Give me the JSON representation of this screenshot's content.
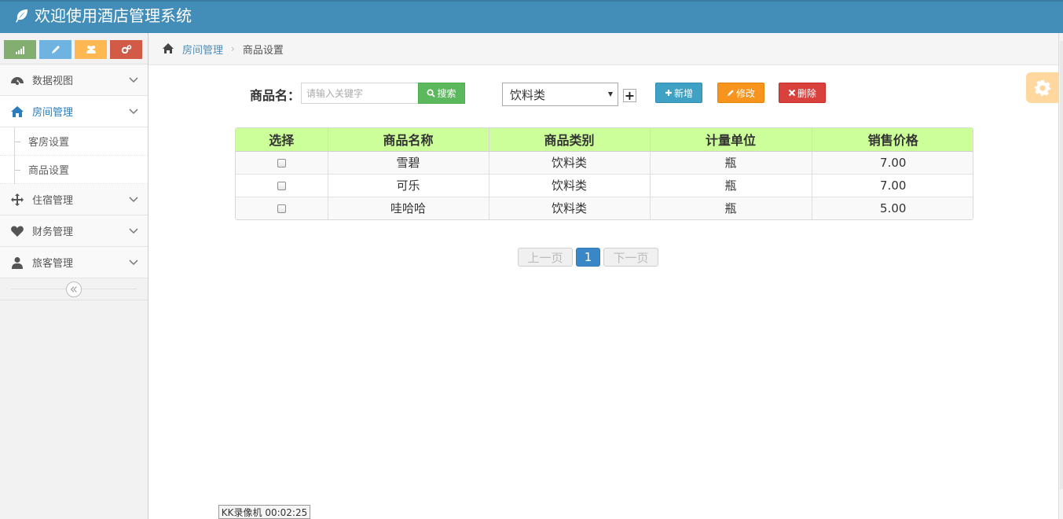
{
  "app": {
    "title": "欢迎使用酒店管理系统"
  },
  "shortcuts": [
    {
      "icon": "signal-icon",
      "color": "#82af6f"
    },
    {
      "icon": "pencil-icon",
      "color": "#6fb3e0"
    },
    {
      "icon": "users-icon",
      "color": "#ffb752"
    },
    {
      "icon": "cogs-icon",
      "color": "#d15b47"
    }
  ],
  "sidebar": {
    "items": [
      {
        "label": "数据视图",
        "icon": "dashboard-icon"
      },
      {
        "label": "房间管理",
        "icon": "home-icon",
        "active": true,
        "children": [
          {
            "label": "客房设置"
          },
          {
            "label": "商品设置"
          }
        ]
      },
      {
        "label": "住宿管理",
        "icon": "move-icon"
      },
      {
        "label": "财务管理",
        "icon": "heart-icon"
      },
      {
        "label": "旅客管理",
        "icon": "user-icon"
      }
    ]
  },
  "breadcrumb": {
    "parent": "房间管理",
    "current": "商品设置"
  },
  "toolbar": {
    "name_label": "商品名：",
    "search_placeholder": "请输入关键字",
    "search_button": "搜索",
    "category_selected": "饮料类",
    "add_button": "新增",
    "edit_button": "修改",
    "delete_button": "删除"
  },
  "table": {
    "headers": [
      "选择",
      "商品名称",
      "商品类别",
      "计量单位",
      "销售价格"
    ],
    "rows": [
      {
        "name": "雪碧",
        "category": "饮料类",
        "unit": "瓶",
        "price": "7.00"
      },
      {
        "name": "可乐",
        "category": "饮料类",
        "unit": "瓶",
        "price": "7.00"
      },
      {
        "name": "哇哈哈",
        "category": "饮料类",
        "unit": "瓶",
        "price": "5.00"
      }
    ]
  },
  "pagination": {
    "prev": "上一页",
    "current": "1",
    "next": "下一页"
  },
  "recorder": {
    "text": "KK录像机 00:02:25"
  }
}
